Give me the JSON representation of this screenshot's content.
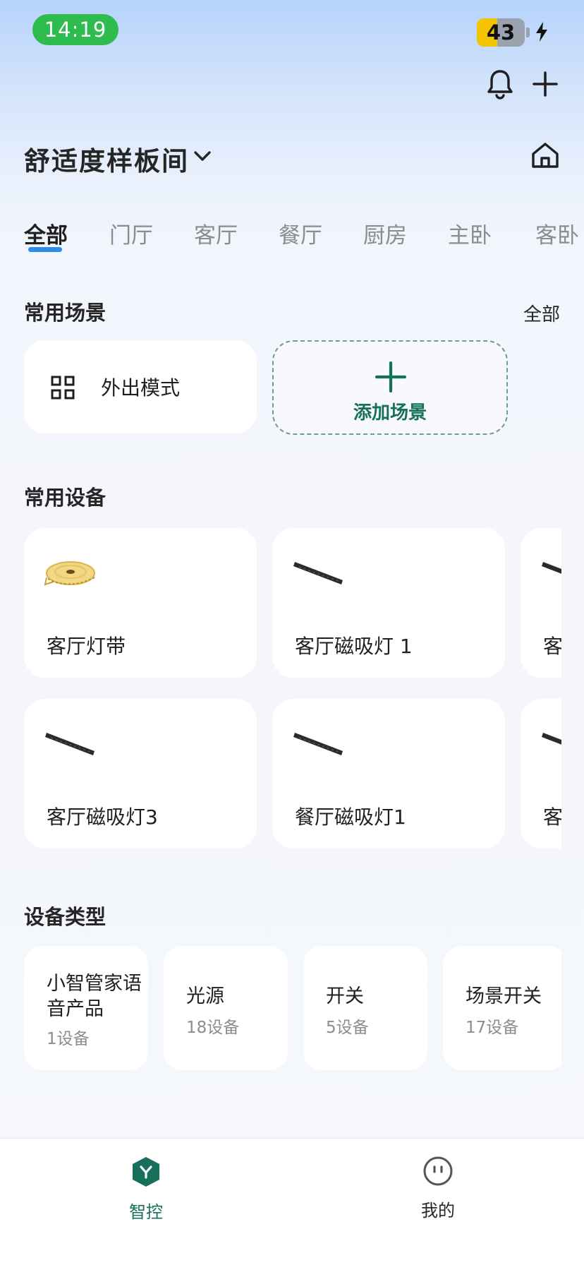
{
  "status_bar": {
    "time": "14:19",
    "battery": "43",
    "battery_percent": 43
  },
  "header": {
    "home_name": "舒适度样板间"
  },
  "tabs": [
    "全部",
    "门厅",
    "客厅",
    "餐厅",
    "厨房",
    "主卧",
    "客卧"
  ],
  "scenes": {
    "title": "常用场景",
    "see_all": "全部",
    "items": [
      {
        "label": "外出模式"
      }
    ],
    "add_label": "添加场景"
  },
  "devices": {
    "title": "常用设备",
    "items": [
      {
        "label": "客厅灯带",
        "icon": "led-strip-roll"
      },
      {
        "label": "客厅磁吸灯 1",
        "icon": "magnetic-track-light"
      },
      {
        "label": "客",
        "icon": "magnetic-track-light"
      },
      {
        "label": "客厅磁吸灯3",
        "icon": "magnetic-track-light"
      },
      {
        "label": "餐厅磁吸灯1",
        "icon": "magnetic-track-light"
      },
      {
        "label": "客",
        "icon": "magnetic-track-light"
      }
    ]
  },
  "device_types": {
    "title": "设备类型",
    "items": [
      {
        "name_line1": "小智管家语",
        "name_line2": "音产品",
        "count": "1设备"
      },
      {
        "name_line1": "光源",
        "count": "18设备"
      },
      {
        "name_line1": "开关",
        "count": "5设备"
      },
      {
        "name_line1": "场景开关",
        "count": "17设备"
      }
    ]
  },
  "bottom_nav": [
    {
      "label": "智控",
      "active": true
    },
    {
      "label": "我的",
      "active": false
    }
  ],
  "colors": {
    "accent_green": "#17705b",
    "tab_indicator": "#2a8ee8",
    "status_green": "#2fbc4f"
  }
}
